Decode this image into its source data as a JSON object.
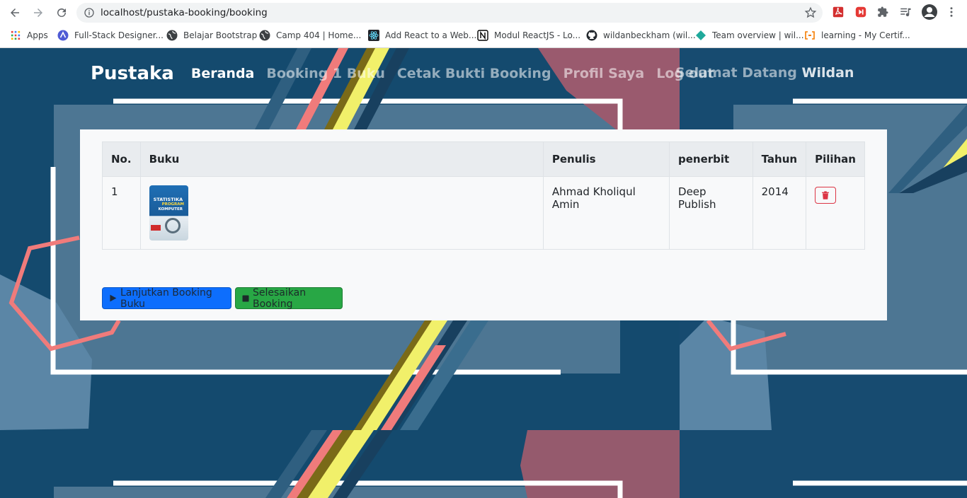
{
  "browser": {
    "url": "localhost/pustaka-booking/booking",
    "bookmarks": [
      {
        "label": "Apps",
        "icon": "apps-grid-icon"
      },
      {
        "label": "Full-Stack Designer...",
        "icon": "bookmark-site-icon"
      },
      {
        "label": "Belajar Bootstrap",
        "icon": "globe-icon"
      },
      {
        "label": "Camp 404 | Home...",
        "icon": "globe-icon"
      },
      {
        "label": "Add React to a Web...",
        "icon": "react-icon"
      },
      {
        "label": "Modul ReactJS - Lo...",
        "icon": "notion-icon"
      },
      {
        "label": "wildanbeckham (wil...",
        "icon": "github-icon"
      },
      {
        "label": "Team overview | wil...",
        "icon": "diamond-icon"
      },
      {
        "label": "learning - My Certif...",
        "icon": "bracket-icon"
      }
    ]
  },
  "nav": {
    "brand": "Pustaka",
    "links": [
      "Beranda",
      "Booking 1 Buku",
      "Cetak Bukti Booking",
      "Profil Saya",
      "Log out"
    ],
    "welcome_prefix": "Selamat Datang",
    "welcome_name": "Wildan"
  },
  "table": {
    "headers": [
      "No.",
      "Buku",
      "Penulis",
      "penerbit",
      "Tahun",
      "Pilihan"
    ],
    "rows": [
      {
        "no": "1",
        "cover_title": "STATISTIKA",
        "cover_sub": "PROGRAM",
        "cover_sub2": "KOMPUTER",
        "penulis": "Ahmad Kholiqul Amin",
        "penerbit": "Deep Publish",
        "tahun": "2014"
      }
    ]
  },
  "buttons": {
    "continue": "Lanjutkan Booking Buku",
    "finish": "Selesaikan Booking"
  },
  "colors": {
    "page_bg": "#144a6e",
    "primary": "#0d6efd",
    "success": "#28a745",
    "danger": "#dc3545"
  }
}
